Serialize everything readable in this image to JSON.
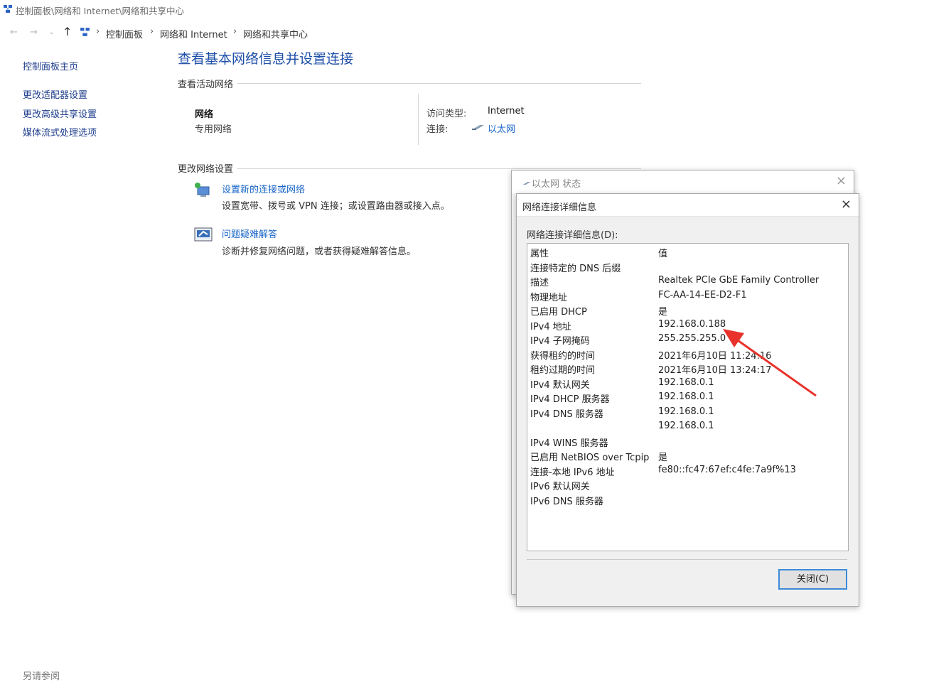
{
  "window": {
    "title": "控制面板\\网络和 Internet\\网络和共享中心"
  },
  "address": {
    "nav": {
      "back": "←",
      "forward": "→",
      "recent": "⌄",
      "up": "↑"
    },
    "sep": "›",
    "crumbs": [
      "控制面板",
      "网络和 Internet",
      "网络和共享中心"
    ]
  },
  "sidebar": {
    "items": [
      {
        "label": "控制面板主页"
      },
      {
        "label": "更改适配器设置"
      },
      {
        "label": "更改高级共享设置"
      },
      {
        "label": "媒体流式处理选项"
      }
    ],
    "see_also": "另请参阅"
  },
  "main": {
    "title": "查看基本网络信息并设置连接",
    "active_section": "查看活动网络",
    "network": {
      "name": "网络",
      "type": "专用网络"
    },
    "access_label": "访问类型:",
    "access_value": "Internet",
    "conn_label": "连接:",
    "conn_value": "以太网",
    "change_section": "更改网络设置",
    "tasks": [
      {
        "title": "设置新的连接或网络",
        "desc": "设置宽带、拨号或 VPN 连接；或设置路由器或接入点。"
      },
      {
        "title": "问题疑难解答",
        "desc": "诊断并修复网络问题，或者获得疑难解答信息。"
      }
    ]
  },
  "status_dialog": {
    "title": "以太网 状态",
    "close": "×"
  },
  "details_dialog": {
    "title": "网络连接详细信息",
    "close": "×",
    "list_label": "网络连接详细信息(D):",
    "header": {
      "property": "属性",
      "value": "值"
    },
    "rows": [
      {
        "k": "连接特定的 DNS 后缀",
        "v": ""
      },
      {
        "k": "描述",
        "v": "Realtek PCIe GbE Family Controller"
      },
      {
        "k": "物理地址",
        "v": "FC-AA-14-EE-D2-F1"
      },
      {
        "k": "已启用 DHCP",
        "v": "是"
      },
      {
        "k": "IPv4 地址",
        "v": "192.168.0.188"
      },
      {
        "k": "IPv4 子网掩码",
        "v": "255.255.255.0"
      },
      {
        "k": "获得租约的时间",
        "v": "2021年6月10日 11:24:16"
      },
      {
        "k": "租约过期的时间",
        "v": "2021年6月10日 13:24:17"
      },
      {
        "k": "IPv4 默认网关",
        "v": "192.168.0.1"
      },
      {
        "k": "IPv4 DHCP 服务器",
        "v": "192.168.0.1"
      },
      {
        "k": "IPv4 DNS 服务器",
        "v": "192.168.0.1"
      },
      {
        "k": "",
        "v": "192.168.0.1"
      },
      {
        "k": "IPv4 WINS 服务器",
        "v": ""
      },
      {
        "k": "已启用 NetBIOS over Tcpip",
        "v": "是"
      },
      {
        "k": "连接-本地 IPv6 地址",
        "v": "fe80::fc47:67ef:c4fe:7a9f%13"
      },
      {
        "k": "IPv6 默认网关",
        "v": ""
      },
      {
        "k": "IPv6 DNS 服务器",
        "v": ""
      }
    ],
    "close_button": "关闭(C)"
  },
  "annotation": {
    "arrow_color": "#e8322b"
  },
  "colors": {
    "link": "#1a66c8",
    "heading": "#1e4fa8"
  }
}
